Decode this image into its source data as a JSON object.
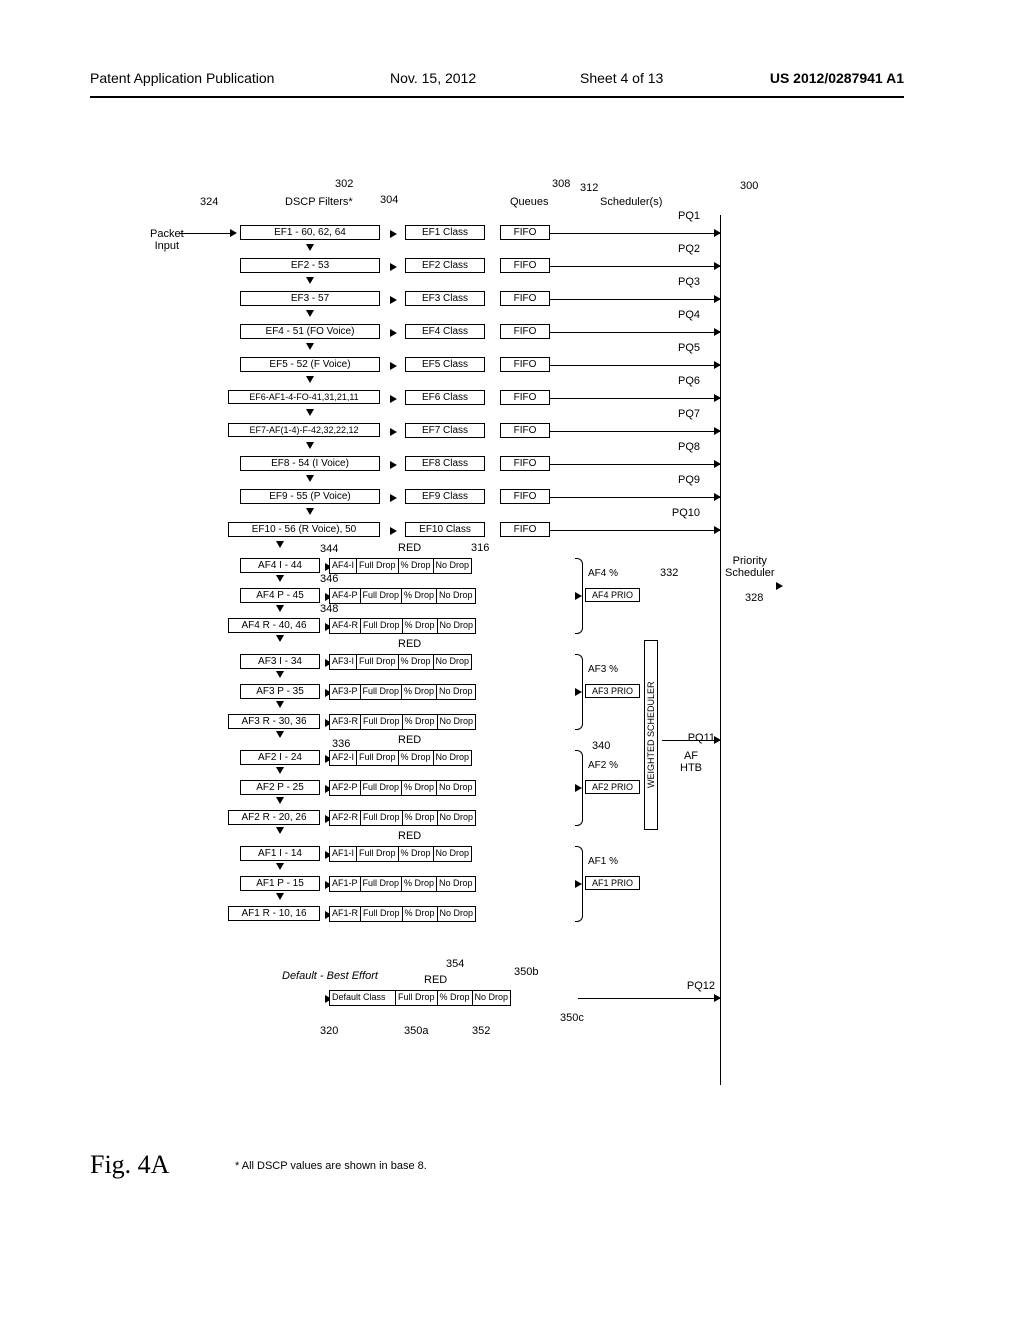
{
  "header": {
    "publication": "Patent Application Publication",
    "date": "Nov. 15, 2012",
    "sheet": "Sheet 4 of 13",
    "pubnum": "US 2012/0287941 A1"
  },
  "labels": {
    "packet_input": "Packet\nInput",
    "dscp_filters": "DSCP Filters*",
    "queues": "Queues",
    "schedulers": "Scheduler(s)",
    "priority_scheduler": "Priority\nScheduler",
    "default_be": "Default - Best Effort",
    "weighted": "WEIGHTED SCHEDULER",
    "af_htb": "AF\nHTB",
    "red": "RED"
  },
  "ef_rows": [
    {
      "filter": "EF1 - 60, 62, 64",
      "class": "EF1 Class",
      "queue": "FIFO",
      "pq": "PQ1"
    },
    {
      "filter": "EF2 - 53",
      "class": "EF2 Class",
      "queue": "FIFO",
      "pq": "PQ2"
    },
    {
      "filter": "EF3 - 57",
      "class": "EF3 Class",
      "queue": "FIFO",
      "pq": "PQ3"
    },
    {
      "filter": "EF4 - 51 (FO Voice)",
      "class": "EF4 Class",
      "queue": "FIFO",
      "pq": "PQ4"
    },
    {
      "filter": "EF5 - 52 (F Voice)",
      "class": "EF5 Class",
      "queue": "FIFO",
      "pq": "PQ5"
    },
    {
      "filter": "EF6-AF1-4-FO-41,31,21,11",
      "class": "EF6 Class",
      "queue": "FIFO",
      "pq": "PQ6"
    },
    {
      "filter": "EF7-AF(1-4)-F-42,32,22,12",
      "class": "EF7 Class",
      "queue": "FIFO",
      "pq": "PQ7"
    },
    {
      "filter": "EF8 - 54 (I Voice)",
      "class": "EF8 Class",
      "queue": "FIFO",
      "pq": "PQ8"
    },
    {
      "filter": "EF9 - 55 (P Voice)",
      "class": "EF9 Class",
      "queue": "FIFO",
      "pq": "PQ9"
    },
    {
      "filter": "EF10 - 56 (R Voice), 50",
      "class": "EF10 Class",
      "queue": "FIFO",
      "pq": "PQ10"
    }
  ],
  "af_groups": [
    {
      "pct_label": "AF4 %",
      "prio_label": "AF4 PRIO",
      "rows": [
        {
          "filter": "AF4 I - 44",
          "cls": "AF4-I"
        },
        {
          "filter": "AF4 P - 45",
          "cls": "AF4-P"
        },
        {
          "filter": "AF4 R - 40, 46",
          "cls": "AF4-R"
        }
      ]
    },
    {
      "pct_label": "AF3 %",
      "prio_label": "AF3 PRIO",
      "rows": [
        {
          "filter": "AF3 I - 34",
          "cls": "AF3-I"
        },
        {
          "filter": "AF3 P - 35",
          "cls": "AF3-P"
        },
        {
          "filter": "AF3 R - 30, 36",
          "cls": "AF3-R"
        }
      ]
    },
    {
      "pct_label": "AF2 %",
      "prio_label": "AF2 PRIO",
      "rows": [
        {
          "filter": "AF2 I - 24",
          "cls": "AF2-I"
        },
        {
          "filter": "AF2 P - 25",
          "cls": "AF2-P"
        },
        {
          "filter": "AF2 R - 20, 26",
          "cls": "AF2-R"
        }
      ]
    },
    {
      "pct_label": "AF1 %",
      "prio_label": "AF1 PRIO",
      "rows": [
        {
          "filter": "AF1 I - 14",
          "cls": "AF1-I"
        },
        {
          "filter": "AF1 P - 15",
          "cls": "AF1-P"
        },
        {
          "filter": "AF1 R - 10, 16",
          "cls": "AF1-R"
        }
      ]
    }
  ],
  "red_segs": {
    "full": "Full Drop",
    "pct": "% Drop",
    "no": "No Drop"
  },
  "default_class": "Default Class",
  "pq11": "PQ11",
  "pq12": "PQ12",
  "refs": {
    "r300": "300",
    "r302": "302",
    "r304": "304",
    "r308": "308",
    "r312": "312",
    "r316": "316",
    "r320": "320",
    "r324": "324",
    "r328": "328",
    "r332": "332",
    "r336": "336",
    "r340": "340",
    "r344": "344",
    "r346": "346",
    "r348": "348",
    "r350a": "350a",
    "r350b": "350b",
    "r350c": "350c",
    "r352": "352",
    "r354": "354"
  },
  "figure": "Fig. 4A",
  "footnote": "* All DSCP values are shown in base 8."
}
